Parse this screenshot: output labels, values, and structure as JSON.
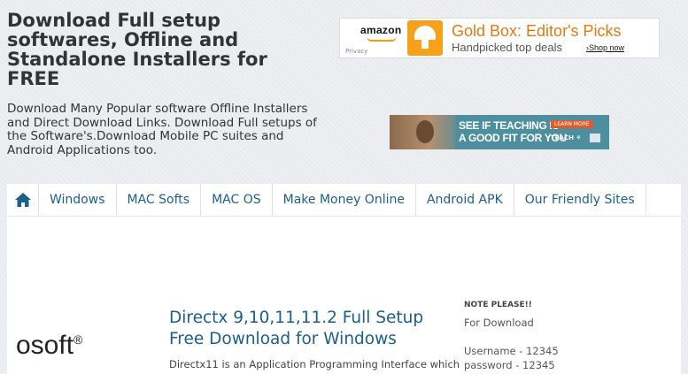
{
  "header": {
    "title": "Download Full setup softwares, Offline and Standalone Installers for FREE",
    "description": "Download Many Popular software Offline Installers and Direct Download Links. Download Full setups of the Software's.Download Mobile PC suites and Android Applications too."
  },
  "ads": {
    "amazon": {
      "brand": "amazon",
      "privacy": "Privacy",
      "headline": "Gold Box: Editor's Picks",
      "sub": "Handpicked top deals",
      "cta": "›Shop now"
    },
    "teach": {
      "line1": "SEE IF TEACHING IS",
      "line2": "A GOOD FIT FOR YOU",
      "button": "LEARN MORE",
      "brand": "TEACH ⚘"
    }
  },
  "nav": {
    "items": [
      {
        "label": "Windows"
      },
      {
        "label": "MAC Softs"
      },
      {
        "label": "MAC OS"
      },
      {
        "label": "Make Money Online"
      },
      {
        "label": "Android APK"
      },
      {
        "label": "Our Friendly Sites"
      }
    ]
  },
  "post": {
    "logo_text": "osoft",
    "logo_mark": "®",
    "title": "Directx 9,10,11,11.2 Full Setup Free Download for Windows",
    "excerpt": "Directx11 is an Application Programming Interface which"
  },
  "sidebar": {
    "heading": "NOTE PLEASE!!",
    "for_download": "For Download",
    "username": "Username - 12345",
    "password": "password - 12345"
  },
  "colors": {
    "link": "#1c5e8c",
    "amazon_orange": "#e47911",
    "background": "#e9ebee"
  },
  "icons": {
    "home": "home-icon"
  }
}
